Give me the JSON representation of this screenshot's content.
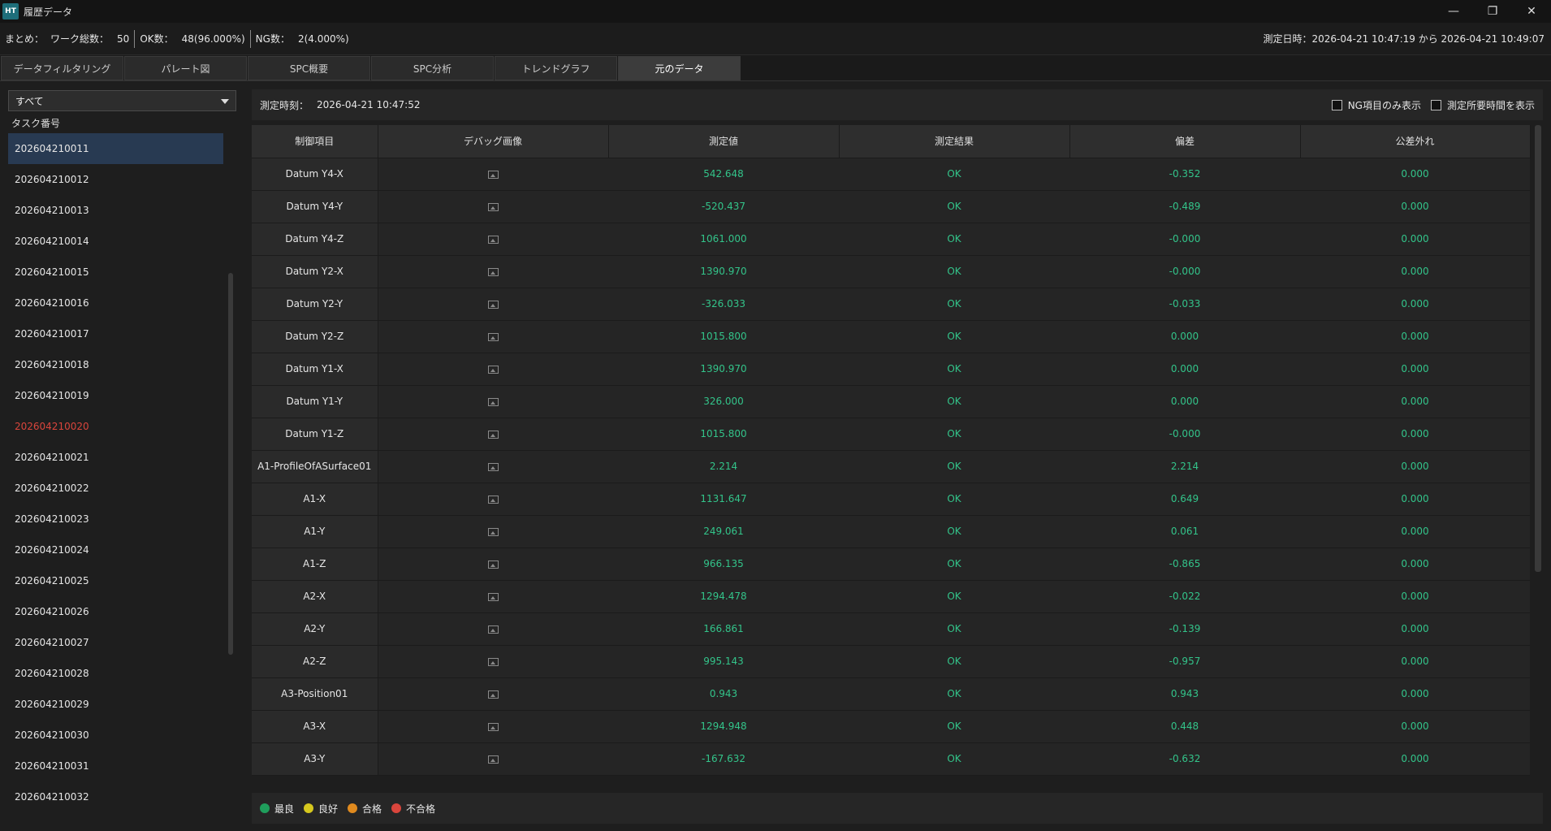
{
  "window": {
    "title": "履歴データ",
    "app_badge": "HT"
  },
  "summary": {
    "label": "まとめ：",
    "total_label": "ワーク総数：",
    "total_value": "50",
    "ok_label": "OK数：",
    "ok_value": "48(96.000%)",
    "ng_label": "NG数：",
    "ng_value": "2(4.000%)",
    "range": "測定日時：2026-04-21 10:47:19 から 2026-04-21 10:49:07"
  },
  "tabs": [
    {
      "label": "データフィルタリング"
    },
    {
      "label": "パレート図"
    },
    {
      "label": "SPC概要"
    },
    {
      "label": "SPC分析"
    },
    {
      "label": "トレンドグラフ"
    },
    {
      "label": "元のデータ"
    }
  ],
  "active_tab_index": 5,
  "sidebar": {
    "filter_value": "すべて",
    "header": "タスク番号",
    "tasks": [
      {
        "id": "202604210011",
        "status": "selected"
      },
      {
        "id": "202604210012",
        "status": "ok"
      },
      {
        "id": "202604210013",
        "status": "ok"
      },
      {
        "id": "202604210014",
        "status": "ok"
      },
      {
        "id": "202604210015",
        "status": "ok"
      },
      {
        "id": "202604210016",
        "status": "ok"
      },
      {
        "id": "202604210017",
        "status": "ok"
      },
      {
        "id": "202604210018",
        "status": "ok"
      },
      {
        "id": "202604210019",
        "status": "ok"
      },
      {
        "id": "202604210020",
        "status": "ng"
      },
      {
        "id": "202604210021",
        "status": "ok"
      },
      {
        "id": "202604210022",
        "status": "ok"
      },
      {
        "id": "202604210023",
        "status": "ok"
      },
      {
        "id": "202604210024",
        "status": "ok"
      },
      {
        "id": "202604210025",
        "status": "ok"
      },
      {
        "id": "202604210026",
        "status": "ok"
      },
      {
        "id": "202604210027",
        "status": "ok"
      },
      {
        "id": "202604210028",
        "status": "ok"
      },
      {
        "id": "202604210029",
        "status": "ok"
      },
      {
        "id": "202604210030",
        "status": "ok"
      },
      {
        "id": "202604210031",
        "status": "ok"
      },
      {
        "id": "202604210032",
        "status": "ok"
      }
    ]
  },
  "main": {
    "measure_time_label": "測定時刻：",
    "measure_time_value": "2026-04-21 10:47:52",
    "chk_ng_only": "NG項目のみ表示",
    "chk_show_duration": "測定所要時間を表示",
    "columns": [
      "制御項目",
      "デバッグ画像",
      "測定値",
      "測定結果",
      "偏差",
      "公差外れ"
    ],
    "rows": [
      {
        "name": "Datum Y4-X",
        "value": "542.648",
        "result": "OK",
        "deviation": "-0.352",
        "out": "0.000"
      },
      {
        "name": "Datum Y4-Y",
        "value": "-520.437",
        "result": "OK",
        "deviation": "-0.489",
        "out": "0.000"
      },
      {
        "name": "Datum Y4-Z",
        "value": "1061.000",
        "result": "OK",
        "deviation": "-0.000",
        "out": "0.000"
      },
      {
        "name": "Datum Y2-X",
        "value": "1390.970",
        "result": "OK",
        "deviation": "-0.000",
        "out": "0.000"
      },
      {
        "name": "Datum Y2-Y",
        "value": "-326.033",
        "result": "OK",
        "deviation": "-0.033",
        "out": "0.000"
      },
      {
        "name": "Datum Y2-Z",
        "value": "1015.800",
        "result": "OK",
        "deviation": "0.000",
        "out": "0.000"
      },
      {
        "name": "Datum Y1-X",
        "value": "1390.970",
        "result": "OK",
        "deviation": "0.000",
        "out": "0.000"
      },
      {
        "name": "Datum Y1-Y",
        "value": "326.000",
        "result": "OK",
        "deviation": "0.000",
        "out": "0.000"
      },
      {
        "name": "Datum Y1-Z",
        "value": "1015.800",
        "result": "OK",
        "deviation": "-0.000",
        "out": "0.000"
      },
      {
        "name": "A1-ProfileOfASurface01",
        "value": "2.214",
        "result": "OK",
        "deviation": "2.214",
        "out": "0.000"
      },
      {
        "name": "A1-X",
        "value": "1131.647",
        "result": "OK",
        "deviation": "0.649",
        "out": "0.000"
      },
      {
        "name": "A1-Y",
        "value": "249.061",
        "result": "OK",
        "deviation": "0.061",
        "out": "0.000"
      },
      {
        "name": "A1-Z",
        "value": "966.135",
        "result": "OK",
        "deviation": "-0.865",
        "out": "0.000"
      },
      {
        "name": "A2-X",
        "value": "1294.478",
        "result": "OK",
        "deviation": "-0.022",
        "out": "0.000"
      },
      {
        "name": "A2-Y",
        "value": "166.861",
        "result": "OK",
        "deviation": "-0.139",
        "out": "0.000"
      },
      {
        "name": "A2-Z",
        "value": "995.143",
        "result": "OK",
        "deviation": "-0.957",
        "out": "0.000"
      },
      {
        "name": "A3-Position01",
        "value": "0.943",
        "result": "OK",
        "deviation": "0.943",
        "out": "0.000"
      },
      {
        "name": "A3-X",
        "value": "1294.948",
        "result": "OK",
        "deviation": "0.448",
        "out": "0.000"
      },
      {
        "name": "A3-Y",
        "value": "-167.632",
        "result": "OK",
        "deviation": "-0.632",
        "out": "0.000"
      }
    ]
  },
  "legend": [
    {
      "label": "最良",
      "color": "#1f9e5c"
    },
    {
      "label": "良好",
      "color": "#d6c81e"
    },
    {
      "label": "合格",
      "color": "#e08a1e"
    },
    {
      "label": "不合格",
      "color": "#d9453c"
    }
  ],
  "colors": {
    "value_text": "#33c48a",
    "ng_text": "#d9453c",
    "selected_bg": "#283a52"
  }
}
